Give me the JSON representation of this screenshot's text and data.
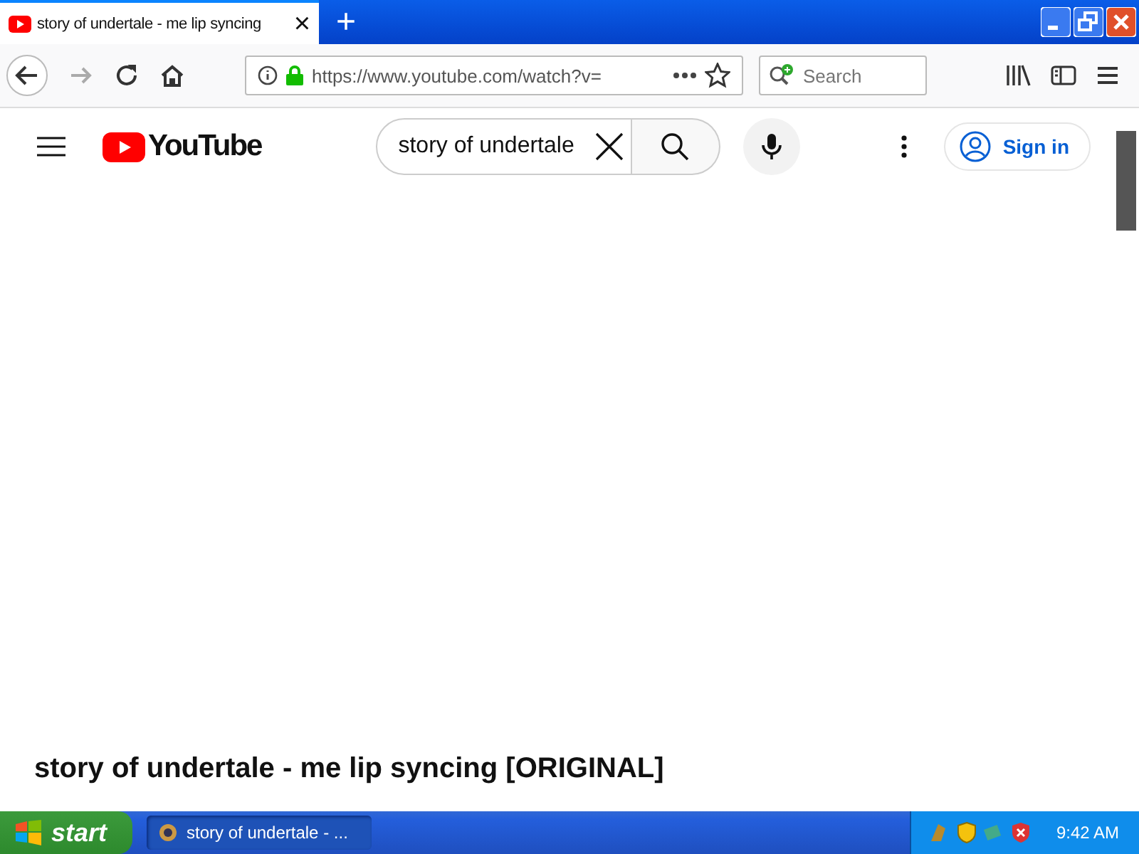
{
  "browser": {
    "tabs": [
      {
        "title": "story of undertale - me lip syncing",
        "selected": true
      }
    ],
    "close_tab": "×",
    "new_tab": "+",
    "url": "https://www.youtube.com/watch?v=",
    "search": {
      "placeholder": "Search"
    }
  },
  "youtube": {
    "logo": "YouTube",
    "search_value": "story of undertale",
    "sign_in": "Sign in",
    "video_title": "story of undertale - me lip syncing [ORIGINAL]"
  },
  "taskbar": {
    "start": "start",
    "windows": [
      {
        "title": "story of undertale - ...",
        "selected": true
      }
    ],
    "clock": "9:42 AM"
  }
}
